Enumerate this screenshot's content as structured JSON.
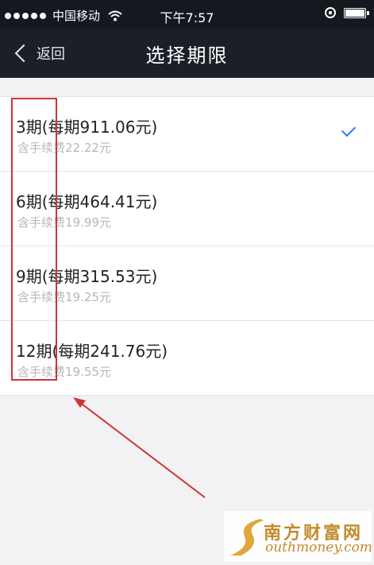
{
  "status_bar": {
    "carrier": "中国移动",
    "time": "下午7:57"
  },
  "nav": {
    "back_label": "返回",
    "title": "选择期限"
  },
  "options": [
    {
      "title": "3期(每期911.06元)",
      "fee": "含手续费22.22元",
      "selected": true
    },
    {
      "title": "6期(每期464.41元)",
      "fee": "含手续费19.99元",
      "selected": false
    },
    {
      "title": "9期(每期315.53元)",
      "fee": "含手续费19.25元",
      "selected": false
    },
    {
      "title": "12期(每期241.76元)",
      "fee": "含手续费19.55元",
      "selected": false
    }
  ],
  "watermark": {
    "name": "南方财富网",
    "site": "outhmoney.com"
  },
  "colors": {
    "nav_background": "#1c1f28",
    "status_background": "#15181f",
    "check": "#2f7be6",
    "annotation": "#d13434",
    "watermark": "#c48a2a"
  }
}
